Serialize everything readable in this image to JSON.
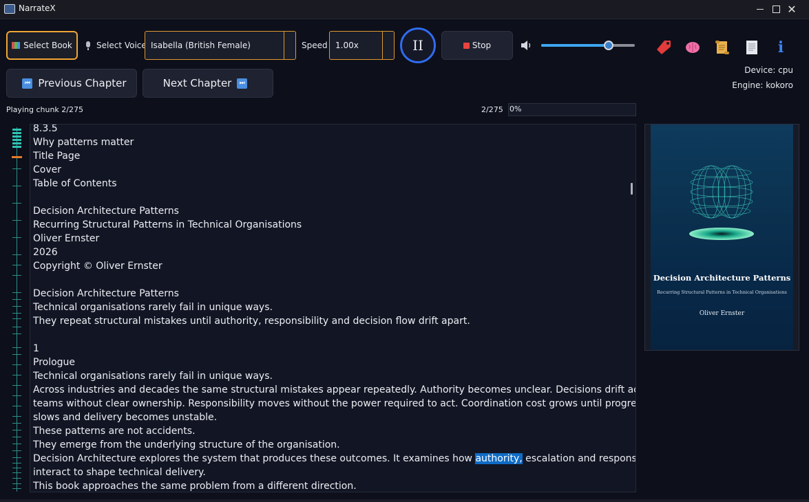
{
  "window": {
    "title": "NarrateX",
    "minimize": "–",
    "maximize": "☐",
    "close": "✕"
  },
  "toolbar": {
    "select_book_label": "Select Book",
    "select_voice_label": "Select Voice",
    "voice_value": "Isabella (British Female)",
    "speed_label": "Speed",
    "speed_value": "1.00x",
    "play_pause_glyph": "II",
    "stop_label": "Stop",
    "volume_level": 0.72,
    "tool_icons": [
      "bookmark-icon",
      "brain-icon",
      "scroll-icon",
      "document-icon",
      "info-icon"
    ],
    "info_glyph": "i"
  },
  "navigation": {
    "previous_label": "Previous Chapter",
    "next_label": "Next Chapter",
    "previous_icon": "⏮",
    "next_icon": "⏭"
  },
  "status": {
    "device": "Device: cpu",
    "engine": "Engine: kokoro",
    "playing": "Playing chunk 2/275",
    "chunk_counter": "2/275",
    "progress_text": "0%",
    "progress_value": 0.0
  },
  "reader": {
    "lines": [
      "8.3.5",
      "Why patterns matter",
      "Title Page",
      "Cover",
      "Table of Contents",
      "",
      "Decision Architecture Patterns",
      "Recurring Structural Patterns in Technical Organisations",
      "Oliver Ernster",
      "2026",
      "Copyright © Oliver Ernster",
      "",
      "Decision Architecture Patterns",
      "Technical organisations rarely fail in unique ways.",
      "They repeat structural mistakes until authority, responsibility and decision flow drift apart.",
      "",
      "1",
      "Prologue",
      "Technical organisations rarely fail in unique ways.",
      "Across industries and decades the same structural mistakes appear repeatedly. Authority becomes unclear. Decisions drift across",
      "teams without clear ownership. Responsibility moves without the power required to act. Coordination cost grows until progress",
      "slows and delivery becomes unstable.",
      "These patterns are not accidents.",
      "They emerge from the underlying structure of the organisation."
    ],
    "highlight_line_before": "Decision Architecture explores the system that produces these outcomes. It examines how ",
    "highlight_word": "authority,",
    "highlight_line_after": " escalation and responsibility",
    "trailing_lines": [
      "interact to shape technical delivery.",
      "This book approaches the same problem from a different direction."
    ]
  },
  "cover": {
    "title": "Decision Architecture Patterns",
    "subtitle": "Recurring Structural Patterns in Technical Organisations",
    "author": "Oliver Ernster"
  },
  "colors": {
    "accent_orange": "#f0a634",
    "accent_blue": "#2f6cf0",
    "highlight": "#0f6cc6",
    "timeline": "#2ec4b4",
    "timeline_current": "#e87a2a"
  }
}
